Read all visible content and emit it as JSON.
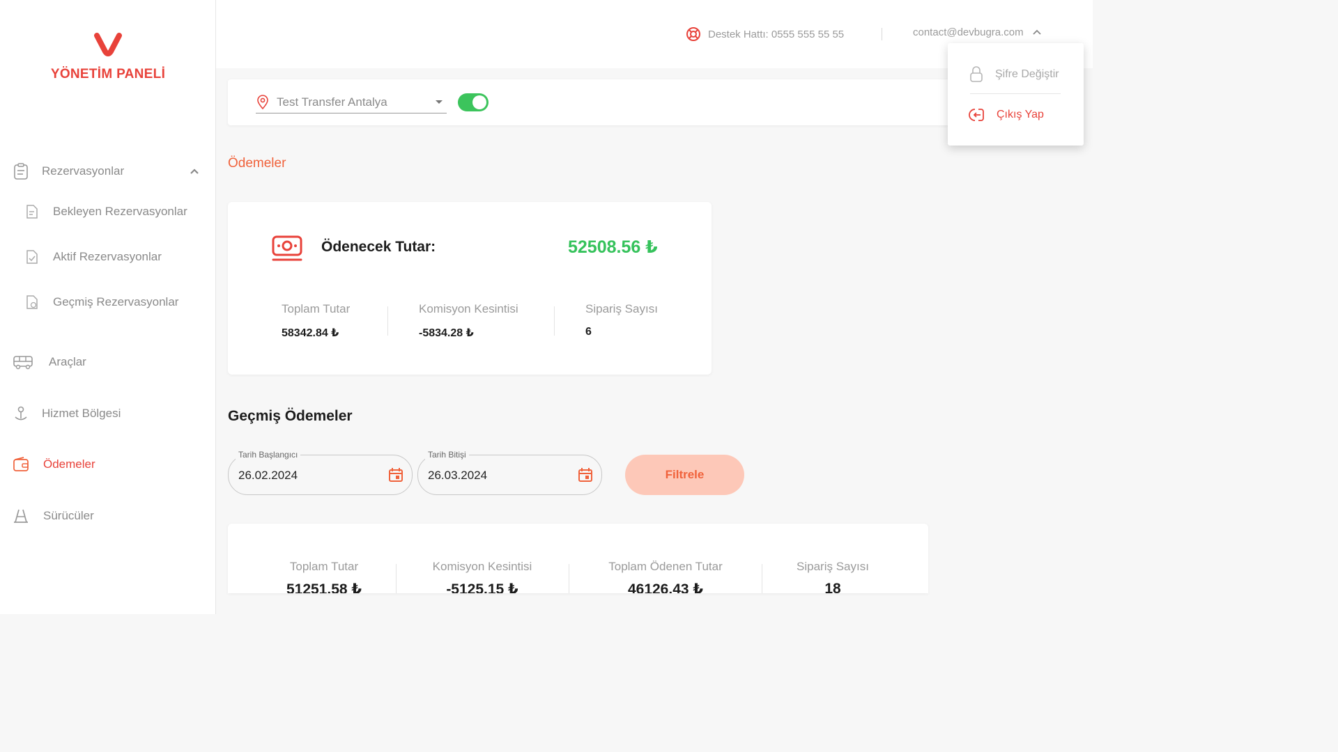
{
  "brand": {
    "title": "YÖNETİM PANELİ",
    "color": "#e8423a"
  },
  "header": {
    "support_text": "Destek Hattı: 0555 555 55 55",
    "account_email": "contact@devbugra.com"
  },
  "account_menu": {
    "change_password": "Şifre Değiştir",
    "logout": "Çıkış Yap"
  },
  "sidebar": {
    "reservations": "Rezervasyonlar",
    "pending": "Bekleyen Rezervasyonlar",
    "active": "Aktif Rezervasyonlar",
    "past": "Geçmiş Rezervasyonlar",
    "vehicles": "Araçlar",
    "service_area": "Hizmet Bölgesi",
    "payments": "Ödemeler",
    "drivers": "Sürücüler"
  },
  "filter": {
    "location": "Test Transfer Antalya",
    "toggle_on": true
  },
  "payments": {
    "section_title": "Ödemeler",
    "due_label": "Ödenecek Tutar:",
    "due_value": "52508.56 ₺",
    "total_label": "Toplam Tutar",
    "total_value": "58342.84 ₺",
    "commission_label": "Komisyon Kesintisi",
    "commission_value": "-5834.28 ₺",
    "orders_label": "Sipariş Sayısı",
    "orders_value": "6"
  },
  "history": {
    "title": "Geçmiş Ödemeler",
    "start_label": "Tarih Başlangıcı",
    "start_value": "26.02.2024",
    "end_label": "Tarih Bitişi",
    "end_value": "26.03.2024",
    "filter_button": "Filtrele",
    "total_label": "Toplam Tutar",
    "total_value": "51251.58 ₺",
    "commission_label": "Komisyon Kesintisi",
    "commission_value": "-5125.15 ₺",
    "paid_label": "Toplam Ödenen Tutar",
    "paid_value": "46126.43 ₺",
    "orders_label": "Sipariş Sayısı",
    "orders_value": "18"
  },
  "colors": {
    "accent": "#e8423a",
    "orange": "#f0623b",
    "green": "#35c25b",
    "button_bg": "#fdc8b8"
  }
}
